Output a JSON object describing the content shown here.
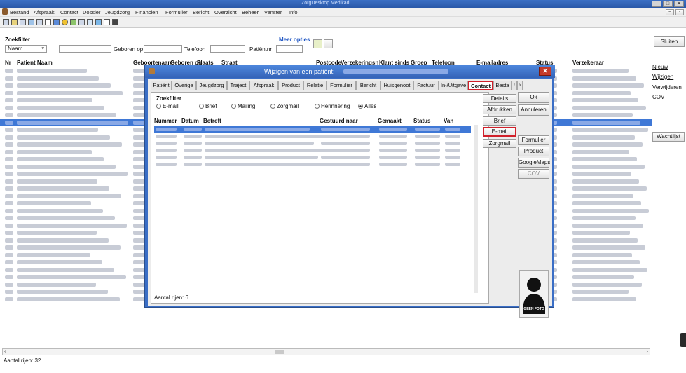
{
  "app": {
    "window_title": "ZorgDesktop Medikad",
    "menu": [
      "Bestand",
      "Afspraak",
      "Contact",
      "Dossier",
      "Jeugdzorg",
      "Financiën",
      "Formulier",
      "Bericht",
      "Overzicht",
      "Beheer",
      "Venster",
      "Info"
    ]
  },
  "filter": {
    "title": "Zoekfilter",
    "field_select": "Naam",
    "born_label": "Geboren op",
    "phone_label": "Telefoon",
    "patient_nr_label": "Patiëntnr",
    "more_options": "Meer opties"
  },
  "grid": {
    "columns": [
      "Nr",
      "Patient Naam",
      "Geboortenaam",
      "Geboren op",
      "Plaats",
      "Straat",
      "Postcode",
      "Verzekeringsn",
      "Klant sinds",
      "Groep",
      "Telefoon",
      "E-mailadres",
      "Status",
      "Verzekeraar"
    ],
    "row_count_label": "Aantal rijen: 32"
  },
  "right_panel": {
    "close": "Sluiten",
    "new": "Nieuw",
    "edit": "Wijzigen",
    "delete": "Verwijderen",
    "cov": "COV",
    "waitlist": "Wachtlijst"
  },
  "dialog": {
    "title": "Wijzigen van een patiënt:",
    "tabs": [
      "Patiënt",
      "Overige",
      "Jeugdzorg",
      "Traject",
      "Afspraak",
      "Product",
      "Relatie",
      "Formulier",
      "Bericht",
      "Huisgenoot",
      "Factuur",
      "In-/Uitgave",
      "Contact",
      "Besta"
    ],
    "active_tab": "Contact",
    "search_filter_label": "Zoekfilter",
    "radios": [
      "E-mail",
      "Brief",
      "Mailing",
      "Zorgmail",
      "Herinnering",
      "Alles"
    ],
    "selected_radio": "Alles",
    "table_columns": [
      "Nummer",
      "Datum",
      "Betreft",
      "Gestuurd naar",
      "Gemaakt",
      "Status",
      "Van"
    ],
    "row_count": "Aantal rijen: 6",
    "side_buttons": [
      "Details",
      "Afdrukken",
      "Brief",
      "E-mail",
      "Zorgmail"
    ],
    "ok": "Ok",
    "cancel": "Annuleren",
    "form_buttons": [
      "Formulier",
      "Product",
      "GoogleMaps",
      "COV"
    ],
    "photo_caption": "GEEN FOTO"
  },
  "colors": {
    "selected_row": "#3f78d6",
    "highlight": "#d0202a"
  }
}
